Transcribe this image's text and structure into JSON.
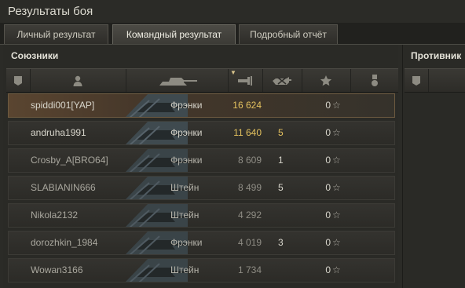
{
  "window": {
    "title": "Результаты боя"
  },
  "tabs": [
    {
      "label": "Личный результат",
      "active": false
    },
    {
      "label": "Командный результат",
      "active": true
    },
    {
      "label": "Подробный отчёт",
      "active": false
    }
  ],
  "allies": {
    "title": "Союзники",
    "columns": [
      {
        "icon": "squad-icon"
      },
      {
        "icon": "player-icon"
      },
      {
        "icon": "tank-icon"
      },
      {
        "icon": "damage-icon",
        "sorted": true
      },
      {
        "icon": "kills-icon"
      },
      {
        "icon": "star-icon"
      },
      {
        "icon": "medal-icon"
      }
    ],
    "players": [
      {
        "name": "spiddi001[YAP]",
        "vehicle": "Фрэнки",
        "damage": "16 624",
        "kills": "",
        "xp": "0",
        "highlight": true
      },
      {
        "name": "andruha1991",
        "vehicle": "Фрэнки",
        "damage": "11 640",
        "kills": "5",
        "xp": "0",
        "highlight": false
      },
      {
        "name": "Crosby_A[BRO64]",
        "vehicle": "Фрэнки",
        "damage": "8 609",
        "kills": "1",
        "xp": "0",
        "highlight": false
      },
      {
        "name": "SLABIANIN666",
        "vehicle": "Штейн",
        "damage": "8 499",
        "kills": "5",
        "xp": "0",
        "highlight": false
      },
      {
        "name": "Nikola2132",
        "vehicle": "Штейн",
        "damage": "4 292",
        "kills": "",
        "xp": "0",
        "highlight": false
      },
      {
        "name": "dorozhkin_1984",
        "vehicle": "Фрэнки",
        "damage": "4 019",
        "kills": "3",
        "xp": "0",
        "highlight": false
      },
      {
        "name": "Wowan3166",
        "vehicle": "Штейн",
        "damage": "1 734",
        "kills": "",
        "xp": "0",
        "highlight": false
      }
    ]
  },
  "enemies": {
    "title": "Противник",
    "columns": [
      {
        "icon": "squad-icon"
      }
    ]
  },
  "colors": {
    "damage_bright": "#e2c05e",
    "damage_dim": "#8f8d85",
    "highlight_row": "#5a4530"
  }
}
